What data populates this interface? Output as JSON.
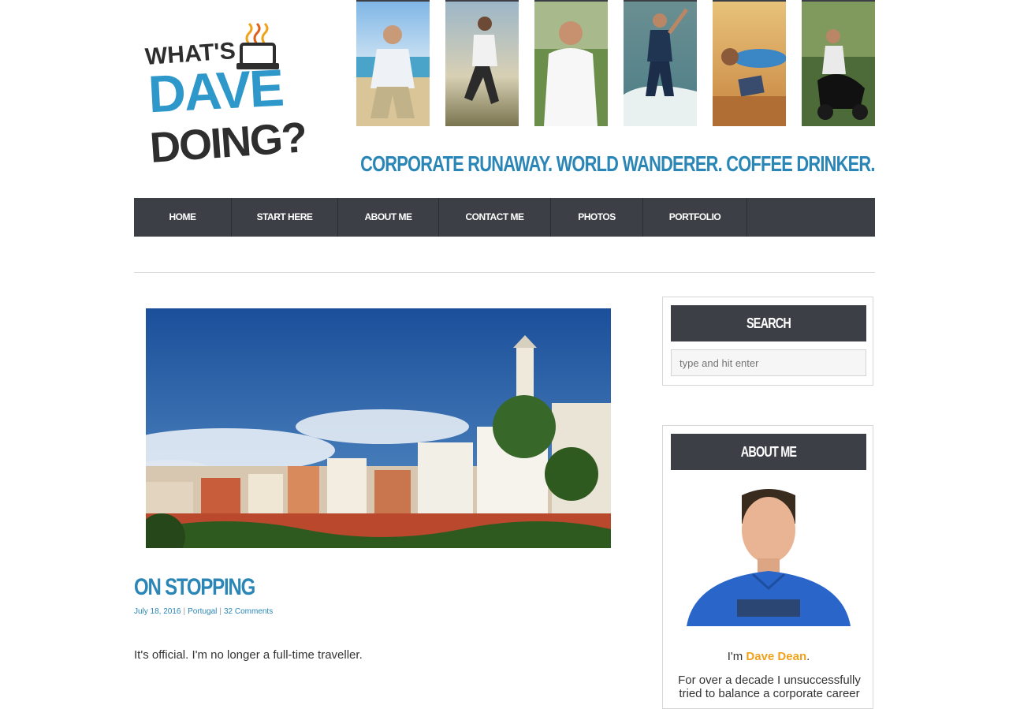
{
  "logo": {
    "line1": "WHAT'S",
    "line2": "DAVE",
    "line3": "DOING?"
  },
  "tagline": "CORPORATE RUNAWAY. WORLD WANDERER. COFFEE DRINKER.",
  "nav": {
    "items": [
      {
        "label": "HOME"
      },
      {
        "label": "START HERE"
      },
      {
        "label": "ABOUT ME"
      },
      {
        "label": "CONTACT ME"
      },
      {
        "label": "PHOTOS"
      },
      {
        "label": "PORTFOLIO"
      }
    ]
  },
  "post": {
    "title": "ON STOPPING",
    "date": "July 18, 2016",
    "category": "Portugal",
    "comments": "32 Comments",
    "lead": "It's official. I'm no longer a full-time traveller."
  },
  "sidebar": {
    "search": {
      "title": "SEARCH",
      "placeholder": "type and hit enter"
    },
    "about": {
      "title": "ABOUT ME",
      "im_prefix": "I'm ",
      "name": "Dave Dean",
      "im_suffix": ".",
      "text": "For over a decade I unsuccessfully tried to balance a corporate career"
    }
  },
  "colors": {
    "accent_blue": "#2a86b6",
    "logo_blue": "#2d98c9",
    "nav_bg": "#3c4046",
    "link_orange": "#f0a21b"
  }
}
